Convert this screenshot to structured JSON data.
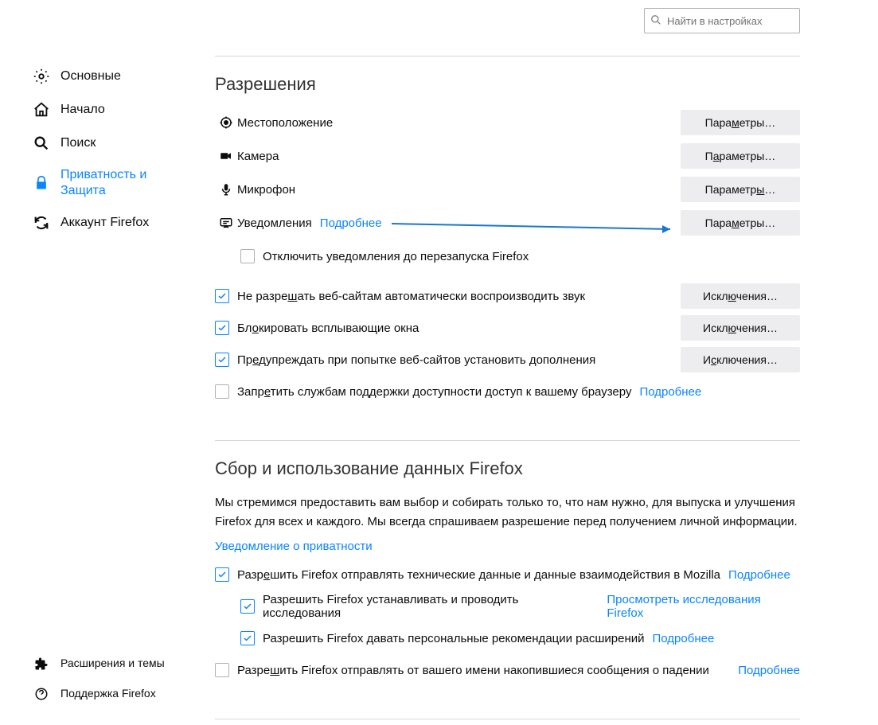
{
  "search": {
    "placeholder": "Найти в настройках"
  },
  "sidebar": {
    "items": [
      {
        "label": "Основные"
      },
      {
        "label": "Начало"
      },
      {
        "label": "Поиск"
      },
      {
        "label": "Приватность и Защита"
      },
      {
        "label": "Аккаунт Firefox"
      }
    ],
    "bottom": [
      {
        "label": "Расширения и темы"
      },
      {
        "label": "Поддержка Firefox"
      }
    ]
  },
  "permissions": {
    "title": "Разрешения",
    "rows": {
      "location": {
        "label": "Местоположение",
        "btn": "Параметры…"
      },
      "camera": {
        "label": "Камера",
        "btn": "Параметры…"
      },
      "microphone": {
        "label": "Микрофон",
        "btn": "Параметры…"
      },
      "notifications": {
        "label": "Уведомления",
        "more": "Подробнее",
        "btn": "Параметры…"
      },
      "disable_until_restart": {
        "label": "Отключить уведомления до перезапуска Firefox"
      }
    },
    "checks": {
      "autoplay": {
        "label": "Не разрешать веб-сайтам автоматически воспроизводить звук",
        "btn": "Исключения…"
      },
      "popup": {
        "label": "Блокировать всплывающие окна",
        "btn": "Исключения…"
      },
      "addons": {
        "label": "Предупреждать при попытке веб-сайтов установить дополнения",
        "btn": "Исключения…"
      },
      "accessibility": {
        "label": "Запретить службам поддержки доступности доступ к вашему браузеру",
        "more": "Подробнее"
      }
    }
  },
  "datacollection": {
    "title": "Сбор и использование данных Firefox",
    "desc": "Мы стремимся предоставить вам выбор и собирать только то, что нам нужно, для выпуска и улучшения Firefox для всех и каждого. Мы всегда спрашиваем разрешение перед получением личной информации.",
    "privacy_link": "Уведомление о приватности",
    "checks": {
      "telemetry": {
        "label": "Разрешить Firefox отправлять технические данные и данные взаимодействия в Mozilla",
        "more": "Подробнее"
      },
      "studies": {
        "label": "Разрешить Firefox устанавливать и проводить исследования",
        "more": "Просмотреть исследования Firefox"
      },
      "recs": {
        "label": "Разрешить Firefox давать персональные рекомендации расширений",
        "more": "Подробнее"
      },
      "crash": {
        "label": "Разрешить Firefox отправлять от вашего имени накопившиеся сообщения о падении",
        "more": "Подробнее"
      }
    }
  }
}
